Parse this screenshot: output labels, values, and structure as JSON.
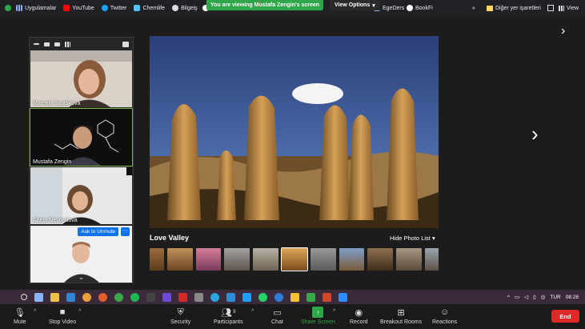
{
  "bookmarks": {
    "items": [
      {
        "label": "Uygulamalar",
        "icon": "apps-grid-icon"
      },
      {
        "label": "YouTube",
        "icon": "youtube-icon"
      },
      {
        "label": "Twitter",
        "icon": "twitter-icon"
      },
      {
        "label": "Chemlife",
        "icon": "chemlife-icon"
      },
      {
        "label": "Bilgeiş",
        "icon": "bilgeis-icon"
      }
    ],
    "right_items": [
      {
        "label": "EgeDers"
      },
      {
        "label": "BookFi"
      }
    ],
    "other": "Diğer yer işaretleri",
    "more": "»",
    "view": "View"
  },
  "share_banner": {
    "text": "You are viewing Mustafa Zengin's screen",
    "view_options": "View Options"
  },
  "gallery": {
    "participants": [
      {
        "name": "Marcela Svatáková"
      },
      {
        "name": "Mustafa Zengin"
      },
      {
        "name": "Aneta Nevoralová"
      },
      {
        "name": ""
      }
    ],
    "ask_to_unmute": "Ask to Unmute",
    "more": "···"
  },
  "viewer": {
    "caption": "Love Valley",
    "hide_list": "Hide Photo List"
  },
  "taskbar": {
    "lang": "TUR",
    "time": "08:28"
  },
  "controls": {
    "mute": "Mute",
    "stop_video": "Stop Video",
    "security": "Security",
    "participants": "Participants",
    "participant_count": "9",
    "chat": "Chat",
    "share_screen": "Share Screen",
    "record": "Record",
    "breakout": "Breakout Rooms",
    "reactions": "Reactions",
    "end": "End"
  },
  "colors": {
    "share_green": "#2ea64a",
    "zoom_blue": "#0e72ed",
    "end_red": "#e02828"
  }
}
